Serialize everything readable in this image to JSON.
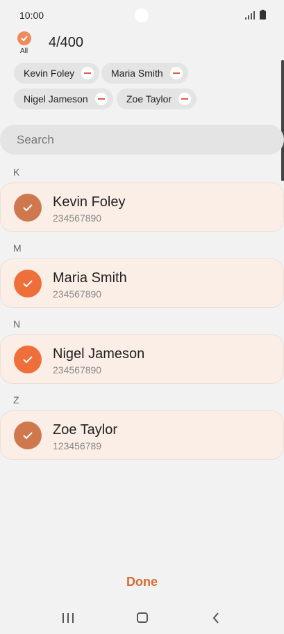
{
  "status_bar": {
    "time": "10:00"
  },
  "header": {
    "all_label": "All",
    "count": "4/400"
  },
  "chips": [
    {
      "label": "Kevin Foley"
    },
    {
      "label": "Maria Smith"
    },
    {
      "label": "Nigel Jameson"
    },
    {
      "label": "Zoe Taylor"
    }
  ],
  "search": {
    "placeholder": "Search"
  },
  "sections": [
    {
      "letter": "K",
      "name": "Kevin Foley",
      "phone": "234567890"
    },
    {
      "letter": "M",
      "name": "Maria Smith",
      "phone": "234567890"
    },
    {
      "letter": "N",
      "name": "Nigel Jameson",
      "phone": "234567890"
    },
    {
      "letter": "Z",
      "name": "Zoe Taylor",
      "phone": "123456789"
    }
  ],
  "footer": {
    "done_label": "Done"
  },
  "colors": {
    "accent": "#d86a30",
    "card_bg": "#fbeee6",
    "check": "#ef6f3a"
  }
}
